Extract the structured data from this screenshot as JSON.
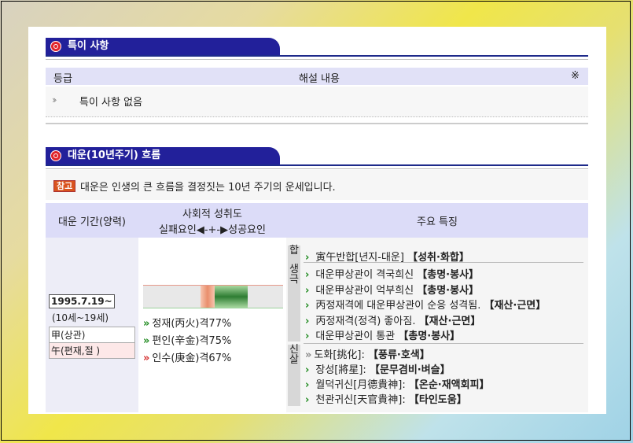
{
  "section1": {
    "title": "특이 사항",
    "header": {
      "grade": "등급",
      "desc": "해설 내용",
      "mark": "※"
    },
    "row": {
      "arrow": "››",
      "text": "특이 사항 없음"
    }
  },
  "section2": {
    "title": "대운(10년주기) 흐름",
    "note": {
      "badge": "참고",
      "text": "대운은 인생의 큰 흐름을 결정짓는 10년 주기의 운세입니다."
    },
    "header": {
      "period": "대운 기간(양력)",
      "achieve_line1": "사회적 성취도",
      "achieve_line2": "실패요인◀-+-▶성공요인",
      "features": "주요 특징"
    },
    "period": {
      "start": "1995.7.19~",
      "age": "(10세~19세)",
      "stem": "甲(상관)",
      "branch": "午(편재,절 )"
    },
    "achievement": {
      "level": 0.6,
      "traits": [
        {
          "arrow": "»",
          "color": "green",
          "text": "정재(丙火)격77%"
        },
        {
          "arrow": "»",
          "color": "green",
          "text": "편인(辛金)격75%"
        },
        {
          "arrow": "»",
          "color": "red",
          "text": "인수(庚金)격67%"
        }
      ]
    },
    "groups": [
      {
        "label": "합",
        "items": [
          {
            "arrow": "›",
            "text": "寅午반합[년지-대운] ",
            "bold": "【성취·화합】"
          }
        ]
      },
      {
        "label": "생극",
        "items": [
          {
            "arrow": "›",
            "text": "대운甲상관이 격국희신 ",
            "bold": "【총명·봉사】"
          },
          {
            "arrow": "›",
            "text": "대운甲상관이 억부희신 ",
            "bold": "【총명·봉사】"
          },
          {
            "arrow": "›",
            "text": "丙정재격에 대운甲상관이 순응 성격됨. ",
            "bold": "【재산·근면】"
          },
          {
            "arrow": "›",
            "text": "丙정재격(정격) 좋아짐. ",
            "bold": "【재산·근면】"
          },
          {
            "arrow": "›",
            "text": "대운甲상관이 통관 ",
            "bold": "【총명·봉사】"
          }
        ]
      },
      {
        "label": "신살",
        "items": [
          {
            "arrow": "»",
            "gray": true,
            "text": "도화[挑化]: ",
            "bold": "【풍류·호색】"
          },
          {
            "arrow": "›",
            "text": "장성[將星]: ",
            "bold": "【문무겸비·벼슬】"
          },
          {
            "arrow": "›",
            "text": "월덕귀신[月德貴神]: ",
            "bold": "【온순·재액회피】"
          },
          {
            "arrow": "›",
            "text": "천관귀신[天官貴神]: ",
            "bold": "【타인도움】"
          }
        ]
      }
    ]
  }
}
